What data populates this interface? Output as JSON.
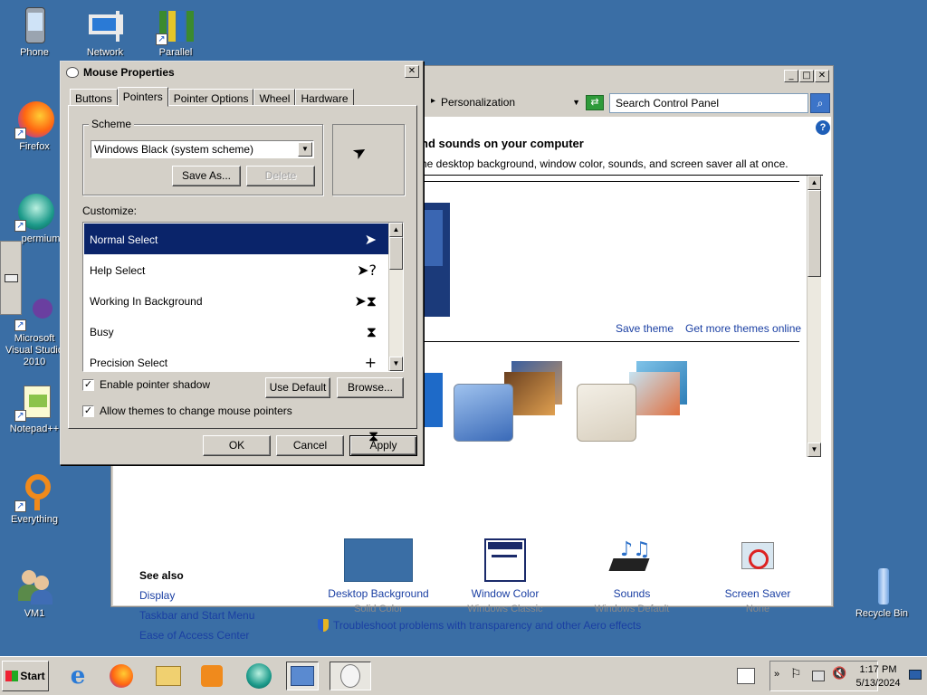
{
  "desktop": {
    "icons": [
      {
        "label": "Phone",
        "icon": "phone-icon"
      },
      {
        "label": "Network",
        "icon": "network-icon"
      },
      {
        "label": "Parallel",
        "icon": "parallel-icon"
      },
      {
        "label": "Firefox",
        "icon": "firefox-icon"
      },
      {
        "label": "permium",
        "icon": "permium-icon"
      },
      {
        "label": "Microsoft Visual Studio 2010",
        "icon": "visual-studio-icon"
      },
      {
        "label": "Notepad++",
        "icon": "notepadpp-icon"
      },
      {
        "label": "Everything",
        "icon": "everything-icon"
      },
      {
        "label": "VM1",
        "icon": "users-icon"
      },
      {
        "label": "Recycle Bin",
        "icon": "recycle-bin-icon"
      }
    ]
  },
  "control_panel": {
    "breadcrumb": "Personalization",
    "search_placeholder": "Search Control Panel",
    "heading": "nd sounds on your computer",
    "description": "he desktop background, window color, sounds, and screen saver all at once.",
    "save_theme": "Save theme",
    "get_more_themes": "Get more themes online",
    "see_also": {
      "title": "See also",
      "links": [
        "Display",
        "Taskbar and Start Menu",
        "Ease of Access Center"
      ]
    },
    "bottom_items": [
      {
        "title": "Desktop Background",
        "subtitle": "Solid Color"
      },
      {
        "title": "Window Color",
        "subtitle": "Windows Classic"
      },
      {
        "title": "Sounds",
        "subtitle": "Windows Default"
      },
      {
        "title": "Screen Saver",
        "subtitle": "None"
      }
    ],
    "troubleshoot": "Troubleshoot problems with transparency and other Aero effects"
  },
  "dialog": {
    "title": "Mouse Properties",
    "tabs": [
      "Buttons",
      "Pointers",
      "Pointer Options",
      "Wheel",
      "Hardware"
    ],
    "active_tab": "Pointers",
    "scheme_label": "Scheme",
    "scheme_value": "Windows Black (system scheme)",
    "save_as": "Save As...",
    "delete": "Delete",
    "customize_label": "Customize:",
    "pointers": [
      {
        "name": "Normal Select",
        "glyph": "➤"
      },
      {
        "name": "Help Select",
        "glyph": "➤?"
      },
      {
        "name": "Working In Background",
        "glyph": "➤⧗"
      },
      {
        "name": "Busy",
        "glyph": "⧗"
      },
      {
        "name": "Precision Select",
        "glyph": "+"
      }
    ],
    "selected_pointer": "Normal Select",
    "enable_shadow": "Enable pointer shadow",
    "allow_themes": "Allow themes to change mouse pointers",
    "use_default": "Use Default",
    "browse": "Browse...",
    "ok": "OK",
    "cancel": "Cancel",
    "apply": "Apply"
  },
  "taskbar": {
    "start": "Start",
    "time": "1:17 PM",
    "date": "5/13/2024"
  },
  "colors": {
    "desktop": "#3a6ea5",
    "selection": "#0a246a",
    "link": "#1a3fa3"
  }
}
